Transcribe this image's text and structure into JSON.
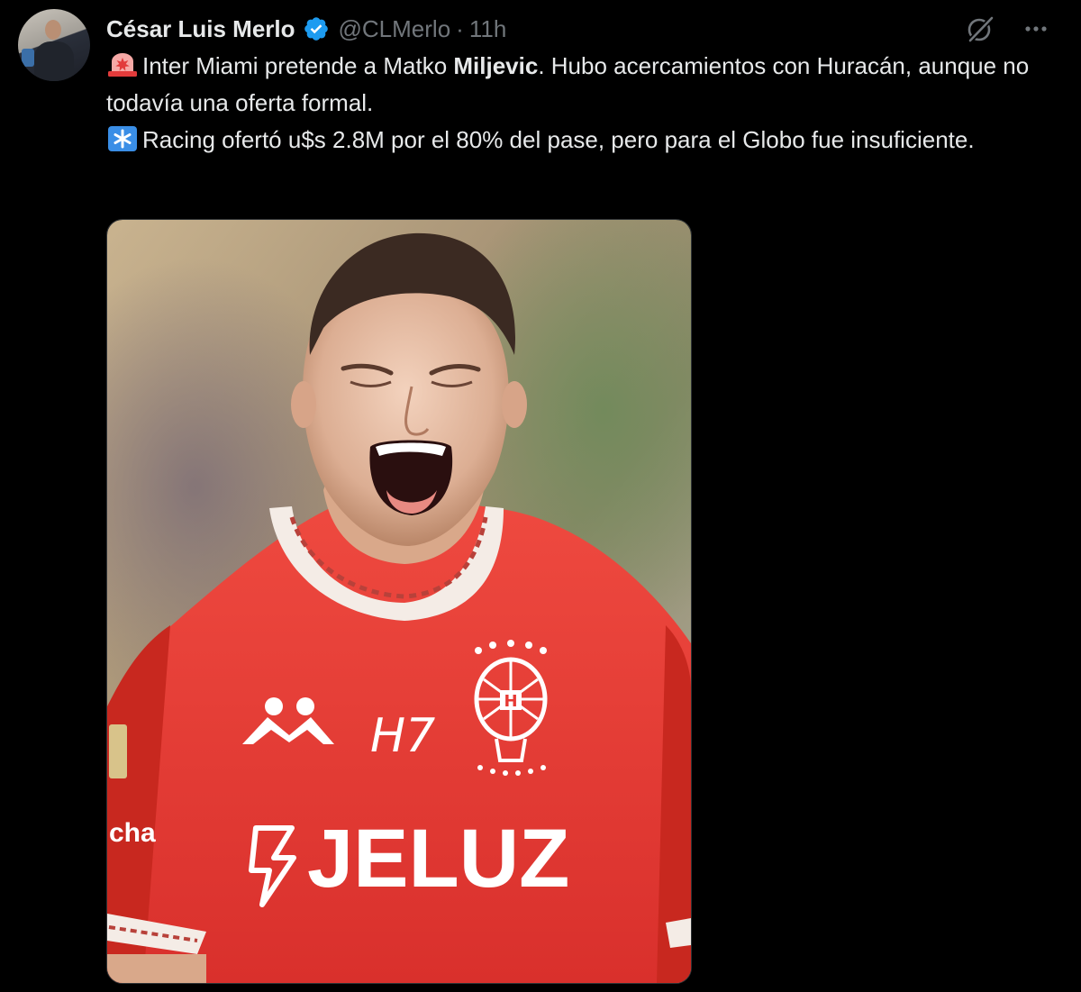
{
  "author": {
    "display_name": "César Luis Merlo",
    "handle": "@CLMerlo",
    "separator": "·",
    "time": "11h",
    "verified": true,
    "verified_color": "#1d9bf0"
  },
  "actions": {
    "grok_icon": "grok-icon",
    "more_icon": "more-icon"
  },
  "tweet": {
    "line1_emoji": "rotating-light-emoji",
    "line1_pre": "Inter Miami pretende a Matko ",
    "line1_bold": "Miljevic",
    "line1_post": ". Hubo acercamientos con Huracán, aunque no todavía una oferta formal.",
    "line2_emoji": "asterisk-emoji",
    "line2_text": "Racing ofertó u$s 2.8M por el 80% del pase, pero para el Globo fue insuficiente."
  },
  "media": {
    "kind": "photo of a football player shouting in a red shirt",
    "shirt_sponsor": "JELUZ",
    "shirt_brand_mark": "H7",
    "sleeve_text": "cha",
    "colors": {
      "shirt": "#e63a34",
      "background": "#b7a487"
    }
  }
}
